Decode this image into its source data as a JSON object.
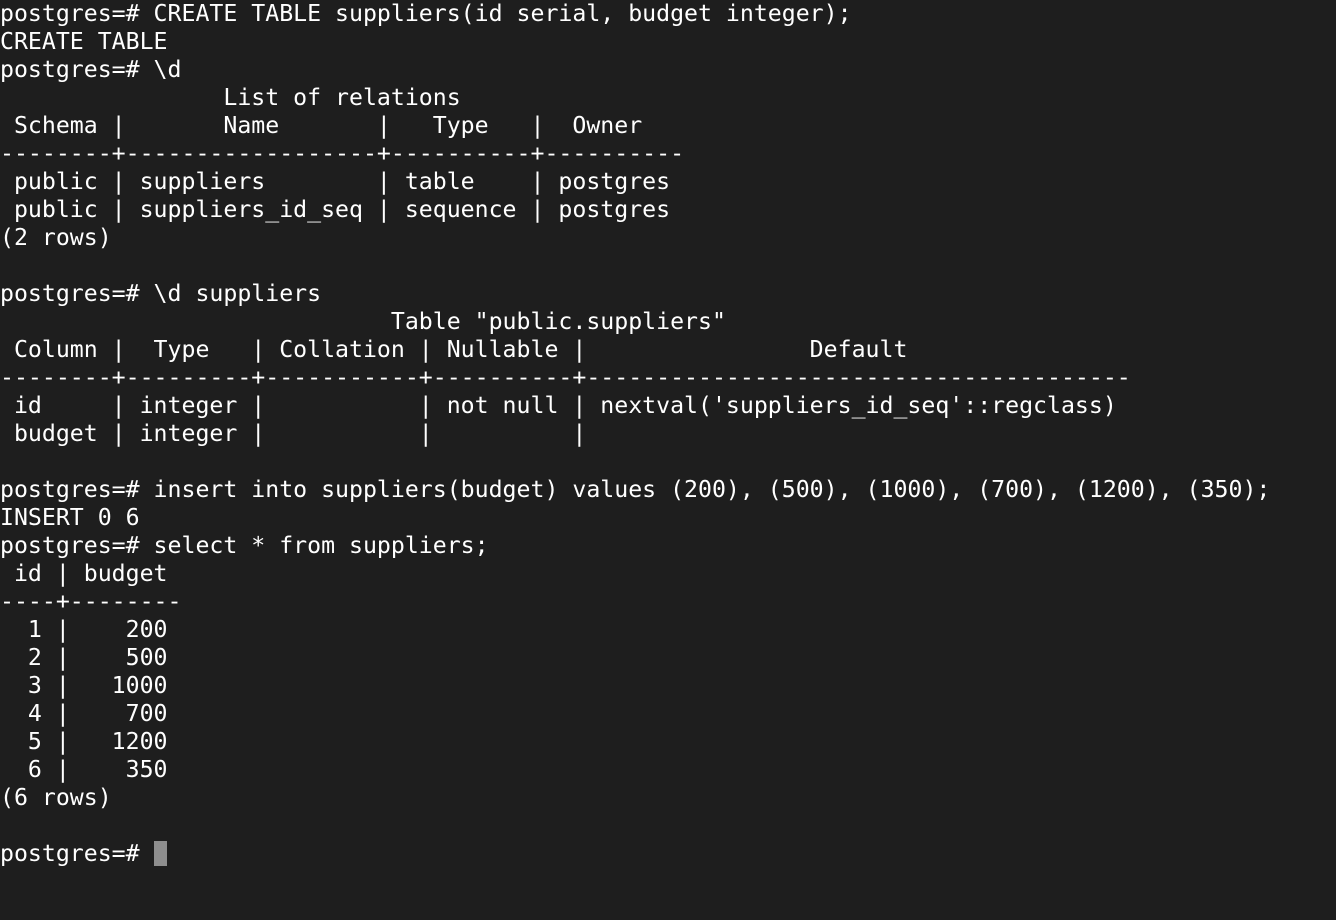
{
  "terminal": {
    "background_color": "#1e1e1e",
    "text_color": "#ffffff",
    "cursor_color": "#8e8e8e",
    "lines": [
      "postgres=# CREATE TABLE suppliers(id serial, budget integer);",
      "CREATE TABLE",
      "postgres=# \\d",
      "                List of relations",
      " Schema |       Name       |   Type   |  Owner",
      "--------+------------------+----------+----------",
      " public | suppliers        | table    | postgres",
      " public | suppliers_id_seq | sequence | postgres",
      "(2 rows)",
      "",
      "postgres=# \\d suppliers",
      "                            Table \"public.suppliers\"",
      " Column |  Type   | Collation | Nullable |                Default",
      "--------+---------+-----------+----------+---------------------------------------",
      " id     | integer |           | not null | nextval('suppliers_id_seq'::regclass)",
      " budget | integer |           |          |",
      "",
      "postgres=# insert into suppliers(budget) values (200), (500), (1000), (700), (1200), (350);",
      "INSERT 0 6",
      "postgres=# select * from suppliers;",
      " id | budget",
      "----+--------",
      "  1 |    200",
      "  2 |    500",
      "  3 |   1000",
      "  4 |    700",
      "  5 |   1200",
      "  6 |    350",
      "(6 rows)",
      ""
    ],
    "prompt": "postgres=# "
  }
}
